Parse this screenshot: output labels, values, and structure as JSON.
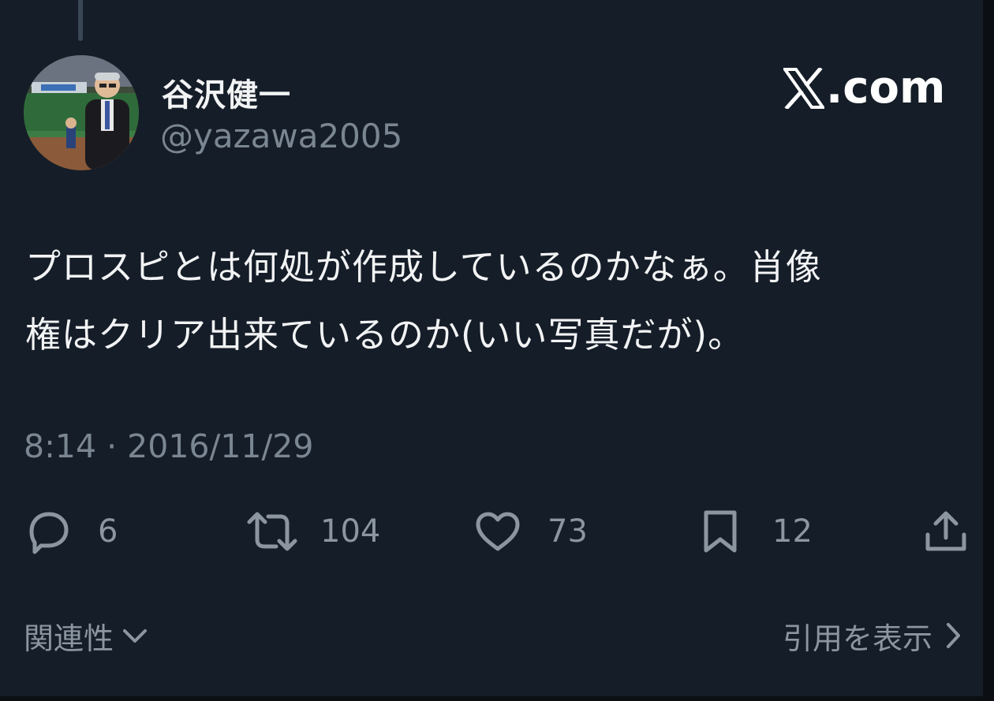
{
  "author": {
    "display_name": "谷沢健一",
    "handle": "@yazawa2005"
  },
  "brand": {
    "text": ".com"
  },
  "tweet": {
    "text_lines": [
      "プロスピとは何処が作成しているのかなぁ。肖像",
      "権はクリア出来ているのか(いい写真だが)。"
    ],
    "timestamp": "8:14 · 2016/11/29"
  },
  "actions": {
    "reply_count": "6",
    "retweet_count": "104",
    "like_count": "73",
    "bookmark_count": "12"
  },
  "footer": {
    "related_label": "関連性",
    "quotes_label": "引用を表示"
  },
  "icons": {
    "reply": "reply-icon",
    "retweet": "retweet-icon",
    "like": "heart-icon",
    "bookmark": "bookmark-icon",
    "share": "share-icon",
    "related_toggle": "chevron-down-icon",
    "quotes_link": "chevron-right-icon"
  }
}
